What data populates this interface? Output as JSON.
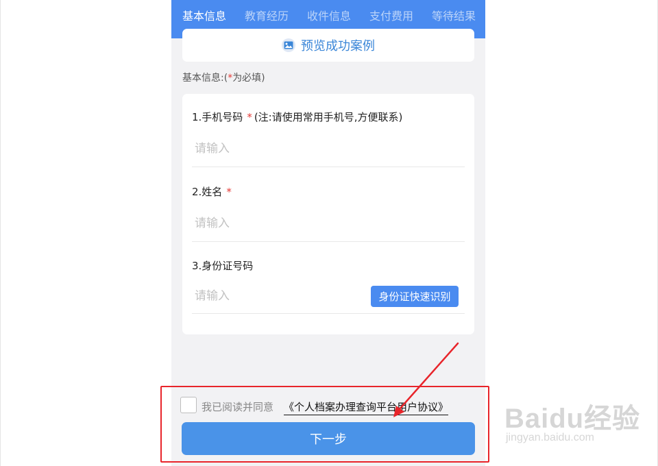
{
  "tabs": [
    {
      "label": "基本信息",
      "active": true
    },
    {
      "label": "教育经历",
      "active": false
    },
    {
      "label": "收件信息",
      "active": false
    },
    {
      "label": "支付费用",
      "active": false
    },
    {
      "label": "等待结果",
      "active": false
    }
  ],
  "preview": {
    "label": "预览成功案例",
    "icon": "image-icon"
  },
  "section": {
    "prefix": "基本信息:(",
    "star": "*",
    "suffix": "为必填)"
  },
  "fields": [
    {
      "label": "1.手机号码",
      "required": "*",
      "note": "(注:请使用常用手机号,方便联系)",
      "placeholder": "请输入",
      "value": ""
    },
    {
      "label": "2.姓名",
      "required": "*",
      "placeholder": "请输入",
      "value": ""
    },
    {
      "label": "3.身份证号码",
      "placeholder": "请输入",
      "value": ""
    }
  ],
  "ocr_button": "身份证快速识别",
  "agreement": {
    "prefix": "我已阅读并同意",
    "link": "《个人档案办理查询平台用户协议》",
    "checked": false
  },
  "next_button": "下一步",
  "watermark": {
    "brand": "Baidu经验",
    "sub": "jingyan.baidu.com"
  },
  "colors": {
    "primary": "#4a8bf0",
    "required": "#e53935",
    "annotation": "#e8242a"
  }
}
